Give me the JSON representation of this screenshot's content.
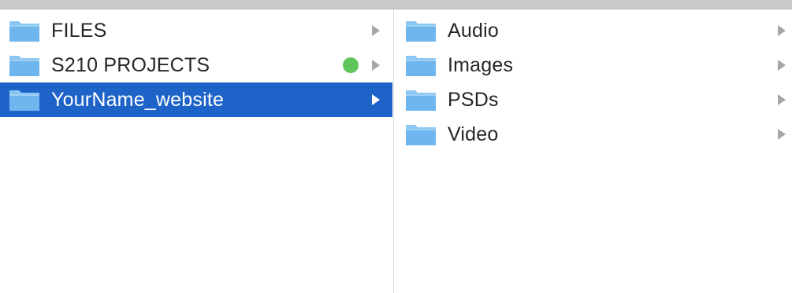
{
  "column_1": {
    "items": [
      {
        "label": "FILES",
        "icon": "folder-icon",
        "selected": false,
        "has_children": true,
        "tag_color": null
      },
      {
        "label": "S210 PROJECTS",
        "icon": "folder-icon",
        "selected": false,
        "has_children": true,
        "tag_color": "#5ec65a"
      },
      {
        "label": "YourName_website",
        "icon": "folder-icon",
        "selected": true,
        "has_children": true,
        "tag_color": null
      }
    ]
  },
  "column_2": {
    "items": [
      {
        "label": "Audio",
        "icon": "folder-icon",
        "selected": false,
        "has_children": true
      },
      {
        "label": "Images",
        "icon": "folder-icon",
        "selected": false,
        "has_children": true
      },
      {
        "label": "PSDs",
        "icon": "folder-icon",
        "selected": false,
        "has_children": true
      },
      {
        "label": "Video",
        "icon": "folder-icon",
        "selected": false,
        "has_children": true
      }
    ]
  },
  "colors": {
    "selection": "#1e63c8",
    "folder_body": "#6fb6ee",
    "folder_tab": "#8cc7f3",
    "chevron": "#a6a6a6",
    "tag_green": "#5ec65a"
  }
}
